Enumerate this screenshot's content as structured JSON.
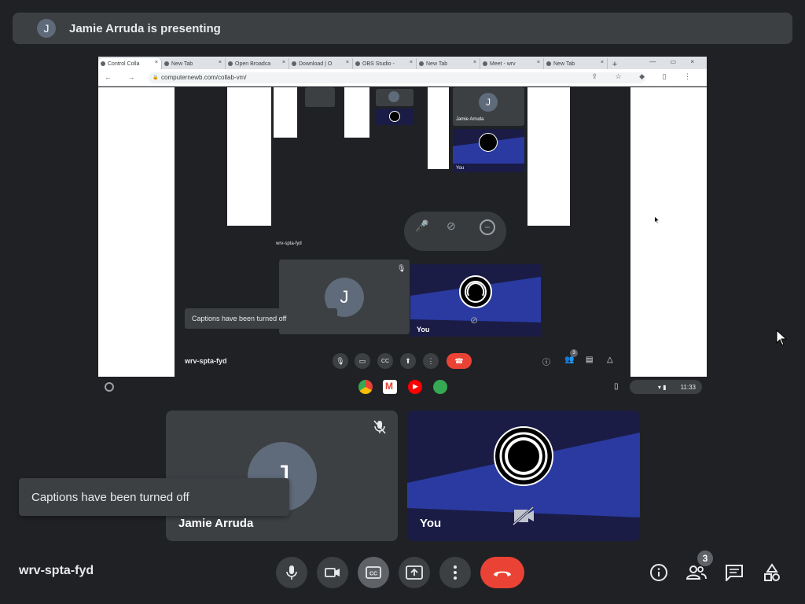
{
  "banner": {
    "avatar_letter": "J",
    "text": "Jamie Arruda is presenting"
  },
  "shared_screen": {
    "tabs": [
      "Control Colla",
      "New Tab",
      "Open Broadca",
      "Download | O",
      "OBS Studio -",
      "New Tab",
      "Meet - wrv",
      "New Tab"
    ],
    "url": "computernewb.com/collab-vm/",
    "inner": {
      "meeting_code": "wrv-spta-fyd",
      "captions": "Captions have been turned off",
      "participant_letter": "J",
      "you_label": "You",
      "nested_name": "Jamie Arruda",
      "nested_code": "wrv-spta-fyd",
      "badge_count": "3"
    },
    "shelf_time": "11:33"
  },
  "tiles": {
    "participant": {
      "name": "Jamie Arruda",
      "letter": "J"
    },
    "self": {
      "name": "You"
    }
  },
  "captions": "Captions have been turned off",
  "meeting_code": "wrv-spta-fyd",
  "people_count": "3",
  "colors": {
    "bg": "#202124",
    "tile": "#3c4043",
    "end_call": "#ea4335",
    "self_tile": "#1a1c46",
    "stripe": "#2a3aa0"
  }
}
